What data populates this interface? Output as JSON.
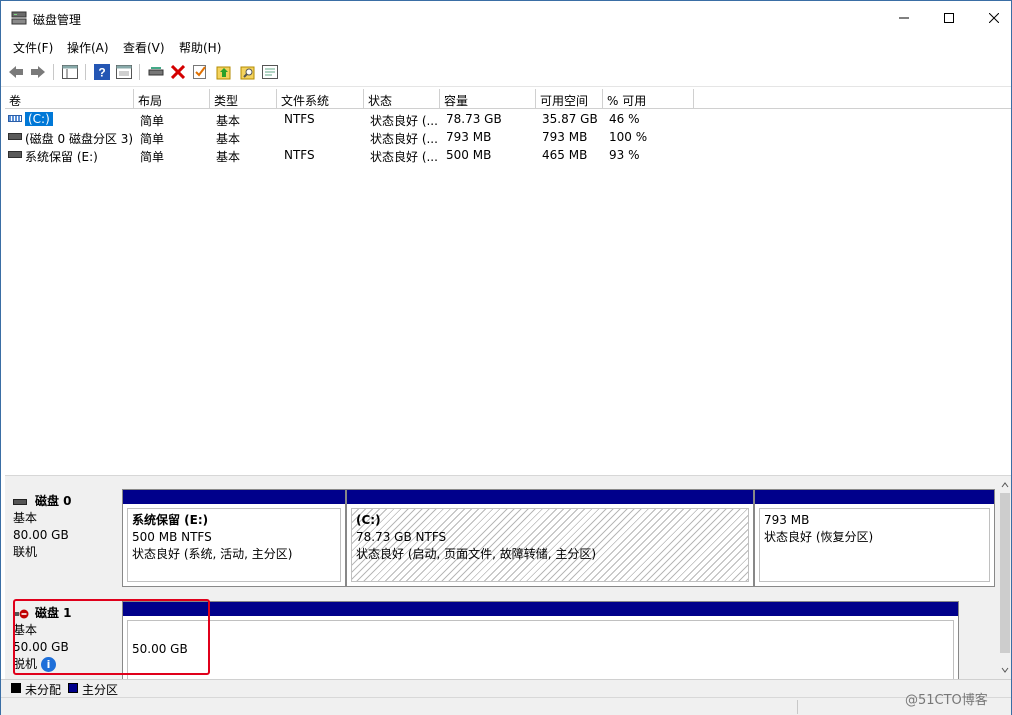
{
  "window": {
    "title": "磁盘管理"
  },
  "menu": [
    "文件(F)",
    "操作(A)",
    "查看(V)",
    "帮助(H)"
  ],
  "toolbar_icons": [
    "back-arrow-icon",
    "forward-arrow-icon",
    "console-tree-icon",
    "help-icon",
    "properties-icon",
    "connect-drive-icon",
    "delete-icon",
    "check-icon",
    "up-arrow-icon",
    "search-icon",
    "settings-icon"
  ],
  "volume_table": {
    "columns": [
      "卷",
      "布局",
      "类型",
      "文件系统",
      "状态",
      "容量",
      "可用空间",
      "% 可用"
    ],
    "rows": [
      [
        "(C:)",
        "简单",
        "基本",
        "NTFS",
        "状态良好 (...",
        "78.73 GB",
        "35.87 GB",
        "46 %"
      ],
      [
        "(磁盘 0 磁盘分区 3)",
        "简单",
        "基本",
        "",
        "状态良好 (...",
        "793 MB",
        "793 MB",
        "100 %"
      ],
      [
        "系统保留 (E:)",
        "简单",
        "基本",
        "NTFS",
        "状态良好 (...",
        "500 MB",
        "465 MB",
        "93 %"
      ]
    ]
  },
  "disks": [
    {
      "name": "磁盘 0",
      "type": "基本",
      "size": "80.00 GB",
      "status": "联机",
      "partitions": [
        {
          "title": "系统保留 (E:)",
          "size": "500 MB NTFS",
          "status": "状态良好 (系统, 活动, 主分区)"
        },
        {
          "title": "(C:)",
          "size": "78.73 GB NTFS",
          "status": "状态良好 (启动, 页面文件, 故障转储, 主分区)"
        },
        {
          "title": "",
          "size": "793 MB",
          "status": "状态良好 (恢复分区)"
        }
      ]
    },
    {
      "name": "磁盘 1",
      "type": "基本",
      "size": "50.00 GB",
      "status": "脱机",
      "partitions": [
        {
          "title": "",
          "size": "50.00 GB",
          "status": ""
        }
      ]
    }
  ],
  "legend": [
    "未分配",
    "主分区"
  ],
  "colors": {
    "primary_partition": "#00008b",
    "unallocated": "#000000",
    "highlight_box": "#e0001b",
    "selection": "#0078d7"
  },
  "watermark": "@51CTO博客"
}
